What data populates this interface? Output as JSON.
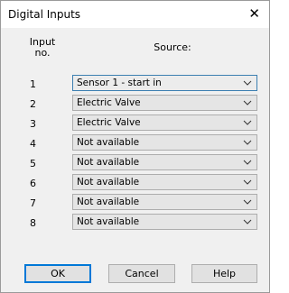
{
  "window": {
    "title": "Digital Inputs",
    "close_glyph": "✕"
  },
  "headers": {
    "input_no": "Input no.",
    "source": "Source:"
  },
  "rows": [
    {
      "no": "1",
      "source": "Sensor 1 - start in"
    },
    {
      "no": "2",
      "source": "Electric Valve"
    },
    {
      "no": "3",
      "source": "Electric Valve"
    },
    {
      "no": "4",
      "source": "Not available"
    },
    {
      "no": "5",
      "source": "Not available"
    },
    {
      "no": "6",
      "source": "Not available"
    },
    {
      "no": "7",
      "source": "Not available"
    },
    {
      "no": "8",
      "source": "Not available"
    }
  ],
  "buttons": {
    "ok": "OK",
    "cancel": "Cancel",
    "help": "Help"
  },
  "colors": {
    "dialog_bg": "#f0f0f0",
    "focus_border": "#3c7fb1",
    "default_button_border": "#0078d7"
  },
  "icons": {
    "close": "close-icon",
    "dropdown": "chevron-down-icon"
  }
}
